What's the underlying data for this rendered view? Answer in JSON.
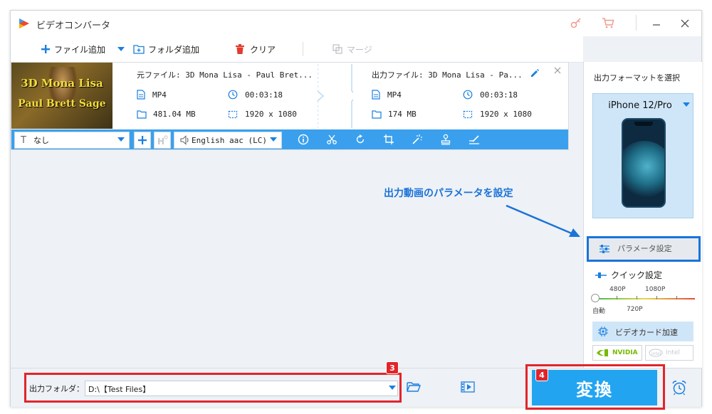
{
  "window": {
    "title": "ビデオコンバータ",
    "controls": {
      "key": "key-icon",
      "cart": "cart-icon",
      "minimize": "—",
      "close": "✕"
    }
  },
  "toolbar": {
    "add_file": "ファイル追加",
    "add_folder": "フォルダ追加",
    "clear": "クリア",
    "merge": "マージ"
  },
  "file": {
    "thumbnail_line1": "3D Mona Lisa",
    "thumbnail_line2": "Paul Brett Sage",
    "source_label": "元ファイル: 3D Mona Lisa - Paul Bret...",
    "source_format": "MP4",
    "source_duration": "00:03:18",
    "source_size": "481.04 MB",
    "source_resolution": "1920 x 1080",
    "output_label": "出力ファイル: 3D Mona Lisa - Pa...",
    "output_format": "MP4",
    "output_duration": "00:03:18",
    "output_size": "174 MB",
    "output_resolution": "1920 x 1080"
  },
  "edit_bar": {
    "subtitle_value": "なし",
    "audio_value": "English aac (LC)"
  },
  "right_panel": {
    "format_heading": "出力フォーマットを選択",
    "device_name": "iPhone 12/Pro",
    "param_button": "パラメータ設定",
    "quick_heading": "クイック設定",
    "res_top": [
      "480P",
      "1080P"
    ],
    "res_bottom": [
      "自動",
      "720P"
    ],
    "slider_level": 0,
    "gpu_button": "ビデオカード加速",
    "nvidia": "NVIDIA",
    "intel": "Intel"
  },
  "annotation": {
    "text": "出力動画のパラメータを設定",
    "color": "#1a73d9"
  },
  "bottom": {
    "output_folder_label": "出力フォルダ：",
    "output_folder_value": "D:\\【Test Files】",
    "convert_label": "変換",
    "badge_3": "3",
    "badge_4": "4"
  },
  "colors": {
    "accent": "#3aa0ee",
    "convert": "#22a4f1",
    "highlight": "#e2242a",
    "annotation": "#1a73d9"
  }
}
